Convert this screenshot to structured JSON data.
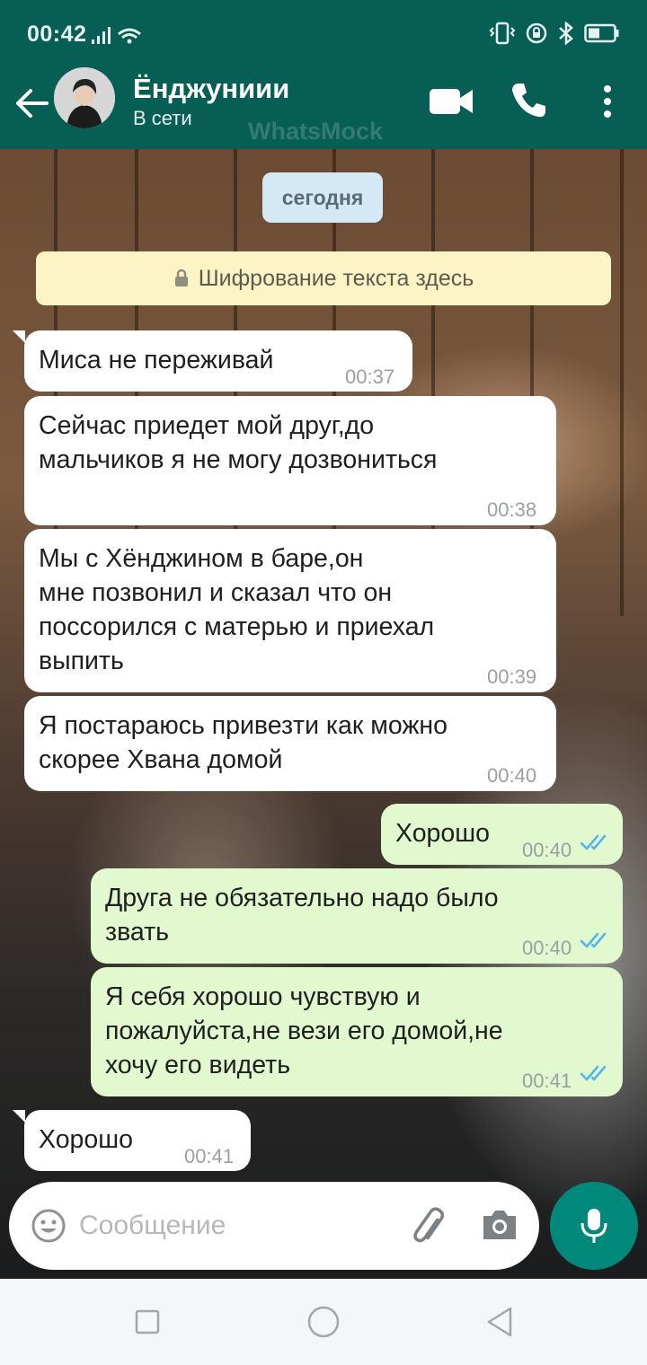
{
  "status_bar": {
    "time": "00:42"
  },
  "header": {
    "contact_name": "Ёнджуниии",
    "contact_status": "В сети",
    "watermark": "WhatsMock"
  },
  "chat": {
    "date_chip": "сегодня",
    "encryption_notice": "Шифрование текста здесь",
    "messages": [
      {
        "direction": "incoming",
        "lines": [
          "Миса не переживай"
        ],
        "time": "00:37"
      },
      {
        "direction": "incoming",
        "lines": [
          "Сейчас приедет мой друг,до",
          "мальчиков я не могу дозвониться"
        ],
        "time": "00:38"
      },
      {
        "direction": "incoming",
        "lines": [
          "Мы с Хёнджином в баре,он",
          "мне позвонил и сказал что он",
          "поссорился с матерью и приехал",
          "выпить"
        ],
        "time": "00:39"
      },
      {
        "direction": "incoming",
        "lines": [
          "Я постараюсь привезти как можно",
          "скорее Хвана домой"
        ],
        "time": "00:40"
      },
      {
        "direction": "outgoing",
        "lines": [
          "Хорошо"
        ],
        "time": "00:40",
        "status": "read"
      },
      {
        "direction": "outgoing",
        "lines": [
          "Друга не обязательно надо было",
          "звать"
        ],
        "time": "00:40",
        "status": "read"
      },
      {
        "direction": "outgoing",
        "lines": [
          "Я себя хорошо чувствую и",
          "пожалуйста,не вези его домой,не",
          "хочу его видеть"
        ],
        "time": "00:41",
        "status": "read"
      },
      {
        "direction": "incoming",
        "lines": [
          "Хорошо"
        ],
        "time": "00:41"
      }
    ]
  },
  "composer": {
    "placeholder": "Сообщение",
    "value": ""
  },
  "colors": {
    "header": "#075e54",
    "incoming_bubble": "#ffffff",
    "outgoing_bubble": "#e2f8cf",
    "read_ticks": "#4fb6ec",
    "mic_button": "#00897b"
  }
}
